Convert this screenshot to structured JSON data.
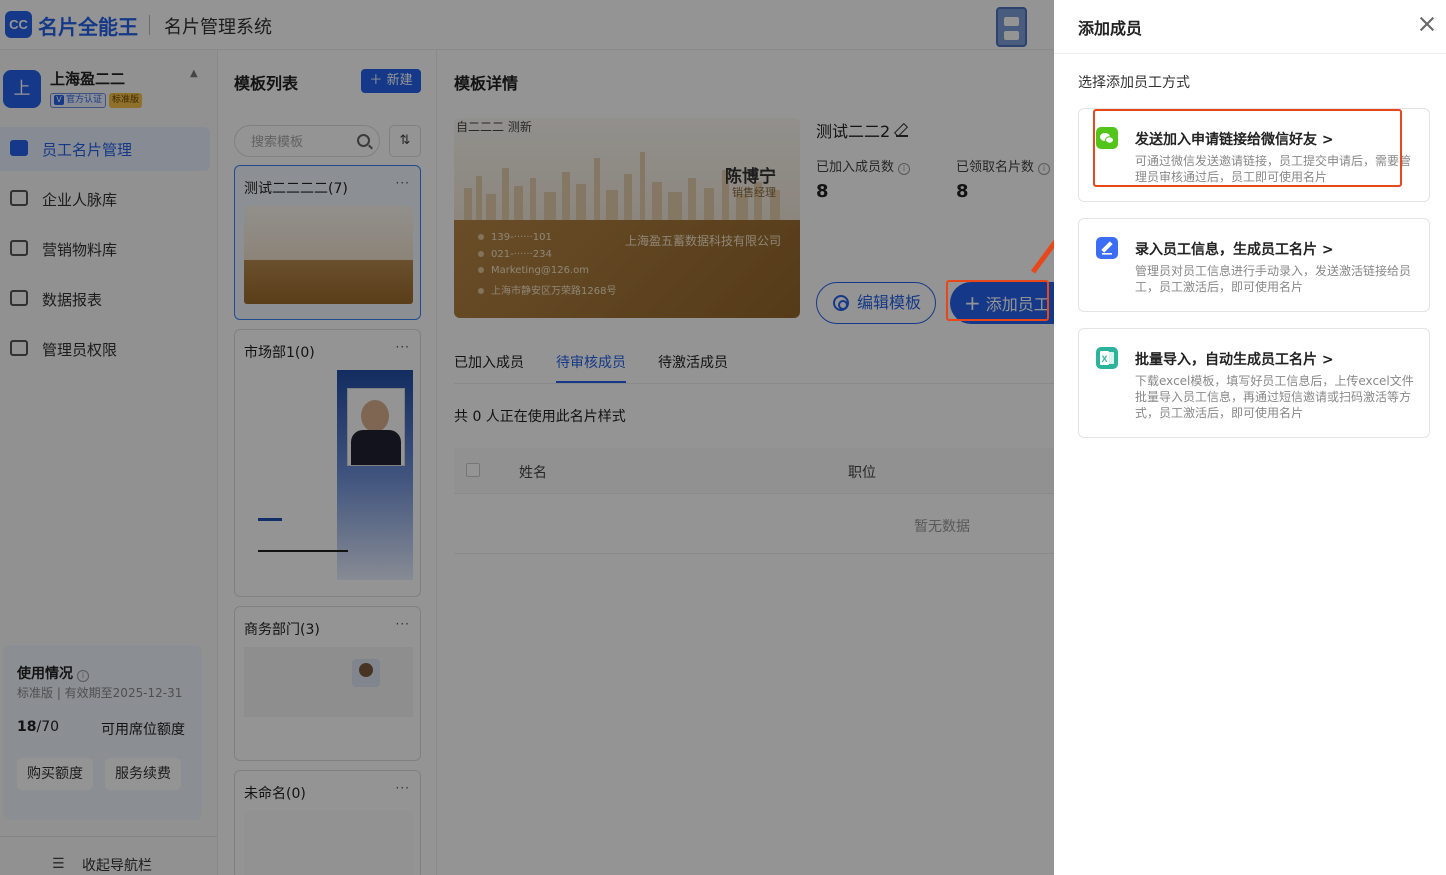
{
  "app": {
    "logo_mark": "CC",
    "logo_text": "名片全能王",
    "system_title": "名片管理系统"
  },
  "sidebar": {
    "company": {
      "avatar": "上",
      "name": "上海盈二二",
      "caret": "▲",
      "verify_tag": "官方认证",
      "plan_tag": "标准版"
    },
    "nav": [
      {
        "label": "员工名片管理",
        "icon": "id-card-icon",
        "active": true
      },
      {
        "label": "企业人脉库",
        "icon": "contacts-icon",
        "active": false
      },
      {
        "label": "营销物料库",
        "icon": "folder-icon",
        "active": false
      },
      {
        "label": "数据报表",
        "icon": "chart-icon",
        "active": false
      },
      {
        "label": "管理员权限",
        "icon": "lock-icon",
        "active": false
      }
    ],
    "usage": {
      "title": "使用情况",
      "plan_text": "标准版 | 有效期至2025-12-31",
      "used": "18",
      "total": "/70",
      "quota_label": "可用席位额度",
      "buy_button": "购买额度",
      "renew_button": "服务续费"
    },
    "collapse_label": "收起导航栏"
  },
  "template_list": {
    "title": "模板列表",
    "new_button": "新建",
    "search_placeholder": "搜索模板",
    "templates": [
      {
        "name": "测试二二二二(7)",
        "more": "···"
      },
      {
        "name": "市场部1(0)",
        "more": "···"
      },
      {
        "name": "商务部门(3)",
        "more": "···"
      },
      {
        "name": "未命名(0)",
        "more": "···"
      }
    ]
  },
  "detail": {
    "title": "模板详情",
    "card": {
      "header_text": "自二二二 测新",
      "person_name": "陈博宁",
      "person_title": "销售经理",
      "phone": "139-······101",
      "tel": "021-······234",
      "email": "Marketing@126.om",
      "address": "上海市静安区万荣路1268号",
      "company": "上海盈五蓄数据科技有限公司"
    },
    "template_name": "测试二二2",
    "stats": [
      {
        "label": "已加入成员数",
        "value": "8"
      },
      {
        "label": "已领取名片数",
        "value": "8"
      }
    ],
    "edit_button": "编辑模板",
    "add_button": "添加员工",
    "tabs": [
      "已加入成员",
      "待审核成员",
      "待激活成员"
    ],
    "active_tab": 1,
    "summary": "共 0 人正在使用此名片样式",
    "columns": [
      "姓名",
      "职位"
    ],
    "empty_text": "暂无数据"
  },
  "drawer": {
    "title": "添加成员",
    "subtitle": "选择添加员工方式",
    "options": [
      {
        "title": "发送加入申请链接给微信好友 >",
        "desc": "可通过微信发送邀请链接，员工提交申请后，需要管理员审核通过后，员工即可使用名片",
        "icon": "wechat-icon",
        "color": "#52c41a"
      },
      {
        "title": "录入员工信息，生成员工名片 >",
        "desc": "管理员对员工信息进行手动录入，发送激活链接给员工，员工激活后，即可使用名片",
        "icon": "edit-icon",
        "color": "#3b6ef5"
      },
      {
        "title": "批量导入，自动生成员工名片 >",
        "desc": "下载excel模板，填写好员工信息后，上传excel文件批量导入员工信息，再通过短信邀请或扫码激活等方式，员工激活后，即可使用名片",
        "icon": "excel-icon",
        "color": "#2bb39b"
      }
    ]
  },
  "colors": {
    "primary": "#2563eb",
    "highlight": "#e8461b",
    "overlay": "rgba(0,0,0,0.42)"
  }
}
